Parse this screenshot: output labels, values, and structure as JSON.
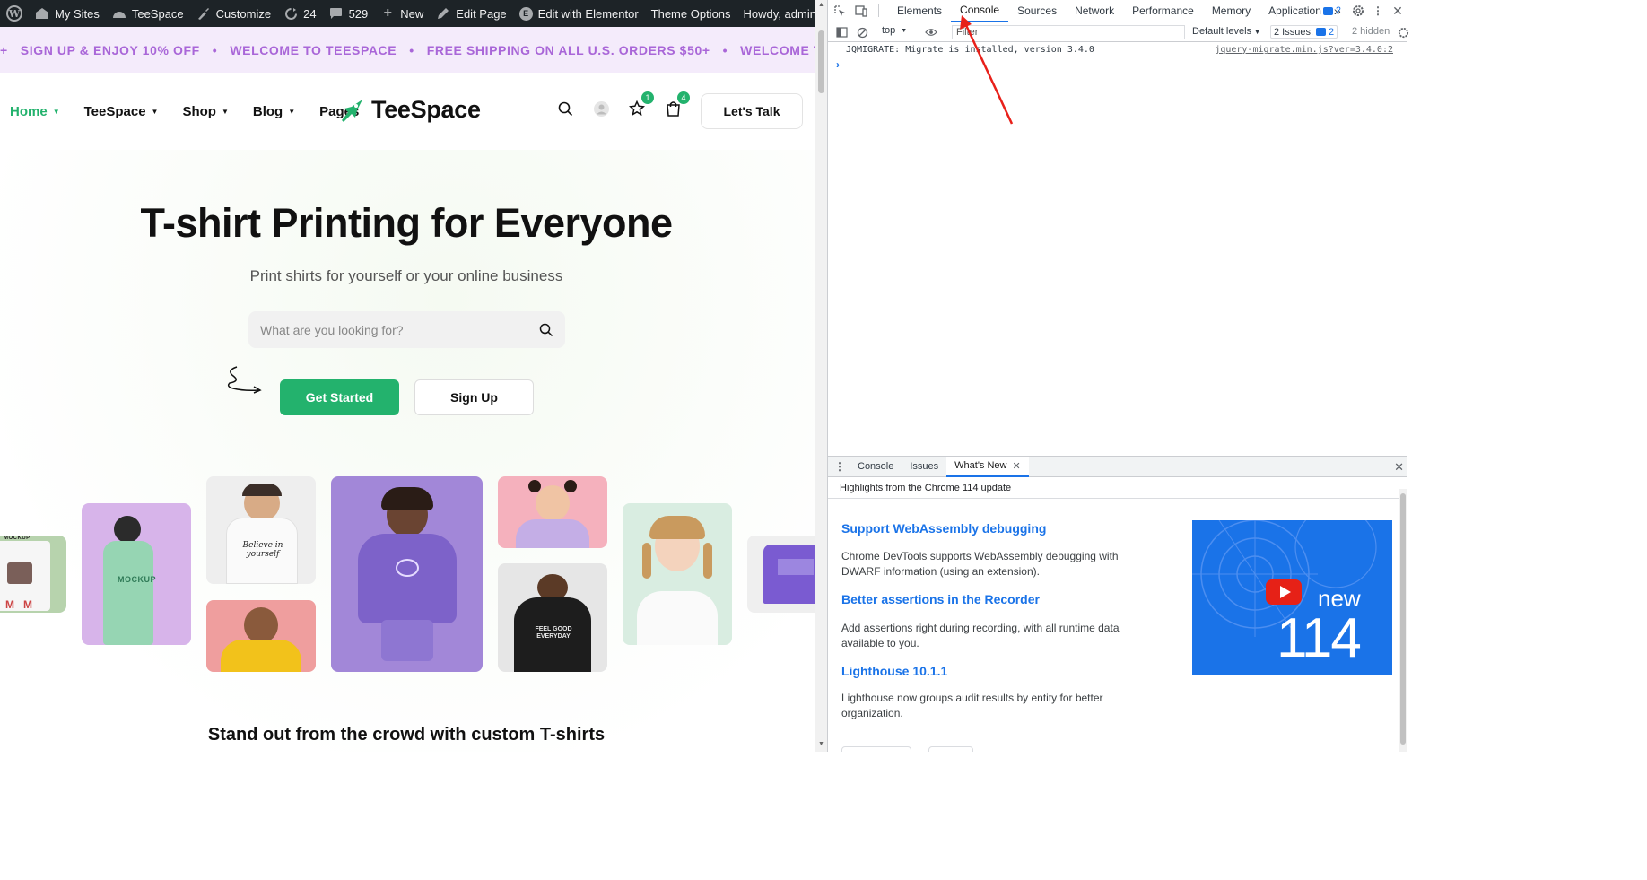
{
  "admin_bar": {
    "my_sites": "My Sites",
    "site_name": "TeeSpace",
    "customize": "Customize",
    "updates": "24",
    "comments": "529",
    "new": "New",
    "edit_page": "Edit Page",
    "edit_elementor": "Edit with Elementor",
    "theme_options": "Theme Options",
    "howdy": "Howdy, admin"
  },
  "promo": {
    "items": [
      "SIGN UP & ENJOY 10% OFF",
      "WELCOME TO TEESPACE",
      "FREE SHIPPING ON ALL U.S. ORDERS $50+",
      "WELCOME T"
    ]
  },
  "nav": {
    "items": [
      {
        "label": "Home",
        "active": true
      },
      {
        "label": "TeeSpace"
      },
      {
        "label": "Shop"
      },
      {
        "label": "Blog"
      },
      {
        "label": "Pages"
      }
    ],
    "logo": "TeeSpace",
    "wishlist_count": "1",
    "cart_count": "4",
    "cta": "Let's Talk"
  },
  "hero": {
    "title": "T-shirt Printing for Everyone",
    "subtitle": "Print shirts for yourself or your online business",
    "search_placeholder": "What are you looking for?",
    "primary_button": "Get Started",
    "secondary_button": "Sign Up",
    "bottom_heading": "Stand out from the crowd with custom T-shirts",
    "photo_labels": {
      "mockup1": "MOCKUP",
      "mockup2": "MOCKUP",
      "believe": "Believe in yourself",
      "feelgood": "FEEL GOOD EVERYDAY"
    }
  },
  "devtools": {
    "tabs": [
      "Elements",
      "Console",
      "Sources",
      "Network",
      "Performance",
      "Memory",
      "Application"
    ],
    "active_tab": "Console",
    "more": "»",
    "issue_count": "2",
    "context": "top",
    "filter_placeholder": "Filter",
    "levels": "Default levels",
    "issues_label": "2 Issues:",
    "issues_num": "2",
    "hidden": "2 hidden",
    "log_message": "JQMIGRATE: Migrate is installed, version 3.4.0",
    "log_source": "jquery-migrate.min.js?ver=3.4.0:2",
    "drawer_tabs": [
      "Console",
      "Issues",
      "What's New"
    ],
    "whats_new_header": "Highlights from the Chrome 114 update",
    "whats_new": [
      {
        "title": "Support WebAssembly debugging",
        "desc": "Chrome DevTools supports WebAssembly debugging with DWARF information (using an extension)."
      },
      {
        "title": "Better assertions in the Recorder",
        "desc": "Add assertions right during recording, with all runtime data available to you."
      },
      {
        "title": "Lighthouse 10.1.1",
        "desc": "Lighthouse now groups audit results by entity for better organization."
      }
    ],
    "banner_new": "new",
    "banner_version": "114"
  },
  "colors": {
    "brand_green": "#23b26d",
    "promo_purple": "#a966d8",
    "promo_bg": "#f4ebfb",
    "devtools_blue": "#1a73e8",
    "annotation_arrow": "#e8201a"
  }
}
